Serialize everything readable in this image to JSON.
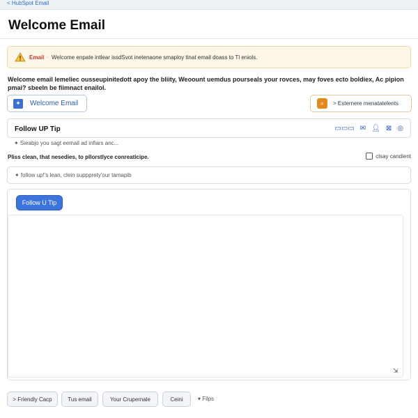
{
  "breadcrumb": "< HubSpot Email",
  "page_title": "Welcome Email",
  "alert": {
    "tag": "Email",
    "separator": "·",
    "message": "Welcome enpate intlear issdSvot inetenaone smaploy tinat email doass to Tl eniols.",
    "color": "#c0392b"
  },
  "description": "Welcome email lemeliec ousseupinitedott apoy the bliity, Weoount uemdus pourseals your rovces, may foves ecto boldiex, Ac pipion pmai? sbeeln be fiimnact enailol.",
  "welcome_button": {
    "label": "Welcome Email",
    "icon": "sparkle-icon"
  },
  "extension_button": {
    "label": "> Esternere menatatelents",
    "icon": "search-icon"
  },
  "tip_section": {
    "title": "Follow UP Tip",
    "tools": [
      "format-icon",
      "image-icon",
      "mail-icon",
      "user-icon",
      "envelope-icon",
      "settings-icon"
    ]
  },
  "sub_hint": "✦ Sieabjo you sagt eemail ad infiars anc...",
  "instruction": "Pliss clean, that nesedies, to pllorstlyce conreaticipe.",
  "clear_link": "clsay candient",
  "input_value": "✦ follow up!'s lean, clein suppprety'our tamapib",
  "primary_button": "Follow U Tip",
  "footer": {
    "buttons": [
      "> Friendly Cacp",
      "Tus email",
      "Your Crupernale",
      "Ceini"
    ],
    "dropdown": "▾ Filps"
  }
}
